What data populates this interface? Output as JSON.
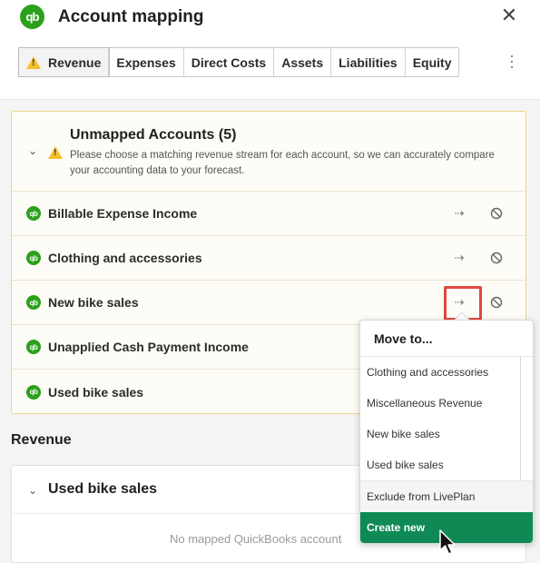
{
  "header": {
    "logo_text": "qb",
    "title": "Account mapping",
    "close_symbol": "✕"
  },
  "tabs": [
    {
      "label": "Revenue",
      "active": true,
      "warning": true
    },
    {
      "label": "Expenses"
    },
    {
      "label": "Direct Costs"
    },
    {
      "label": "Assets"
    },
    {
      "label": "Liabilities"
    },
    {
      "label": "Equity"
    }
  ],
  "unmapped": {
    "title": "Unmapped Accounts (5)",
    "description": "Please choose a matching revenue stream for each account, so we can accurately compare your accounting data to your forecast.",
    "rows": [
      {
        "label": "Billable Expense Income"
      },
      {
        "label": "Clothing and accessories"
      },
      {
        "label": "New bike sales"
      },
      {
        "label": "Unapplied Cash Payment Income"
      },
      {
        "label": "Used bike sales"
      }
    ]
  },
  "revenue": {
    "section_title": "Revenue",
    "card_title": "Used bike sales",
    "empty_text": "No mapped QuickBooks account"
  },
  "move_menu": {
    "title": "Move to...",
    "options": [
      "Clothing and accessories",
      "Miscellaneous Revenue",
      "New bike sales",
      "Used bike sales"
    ],
    "exclude_label": "Exclude from LivePlan",
    "create_label": "Create new"
  },
  "colors": {
    "brand_green": "#2ca01c",
    "warning_yellow": "#f4bf2a",
    "action_green": "#108a55",
    "highlight_red": "#e3473f"
  },
  "icons": {
    "logo": "quickbooks-logo-icon",
    "close": "close-icon",
    "warning": "warning-icon",
    "more": "kebab-menu-icon",
    "collapse": "chevron-down-icon",
    "move": "move-icon",
    "exclude": "ban-icon"
  }
}
